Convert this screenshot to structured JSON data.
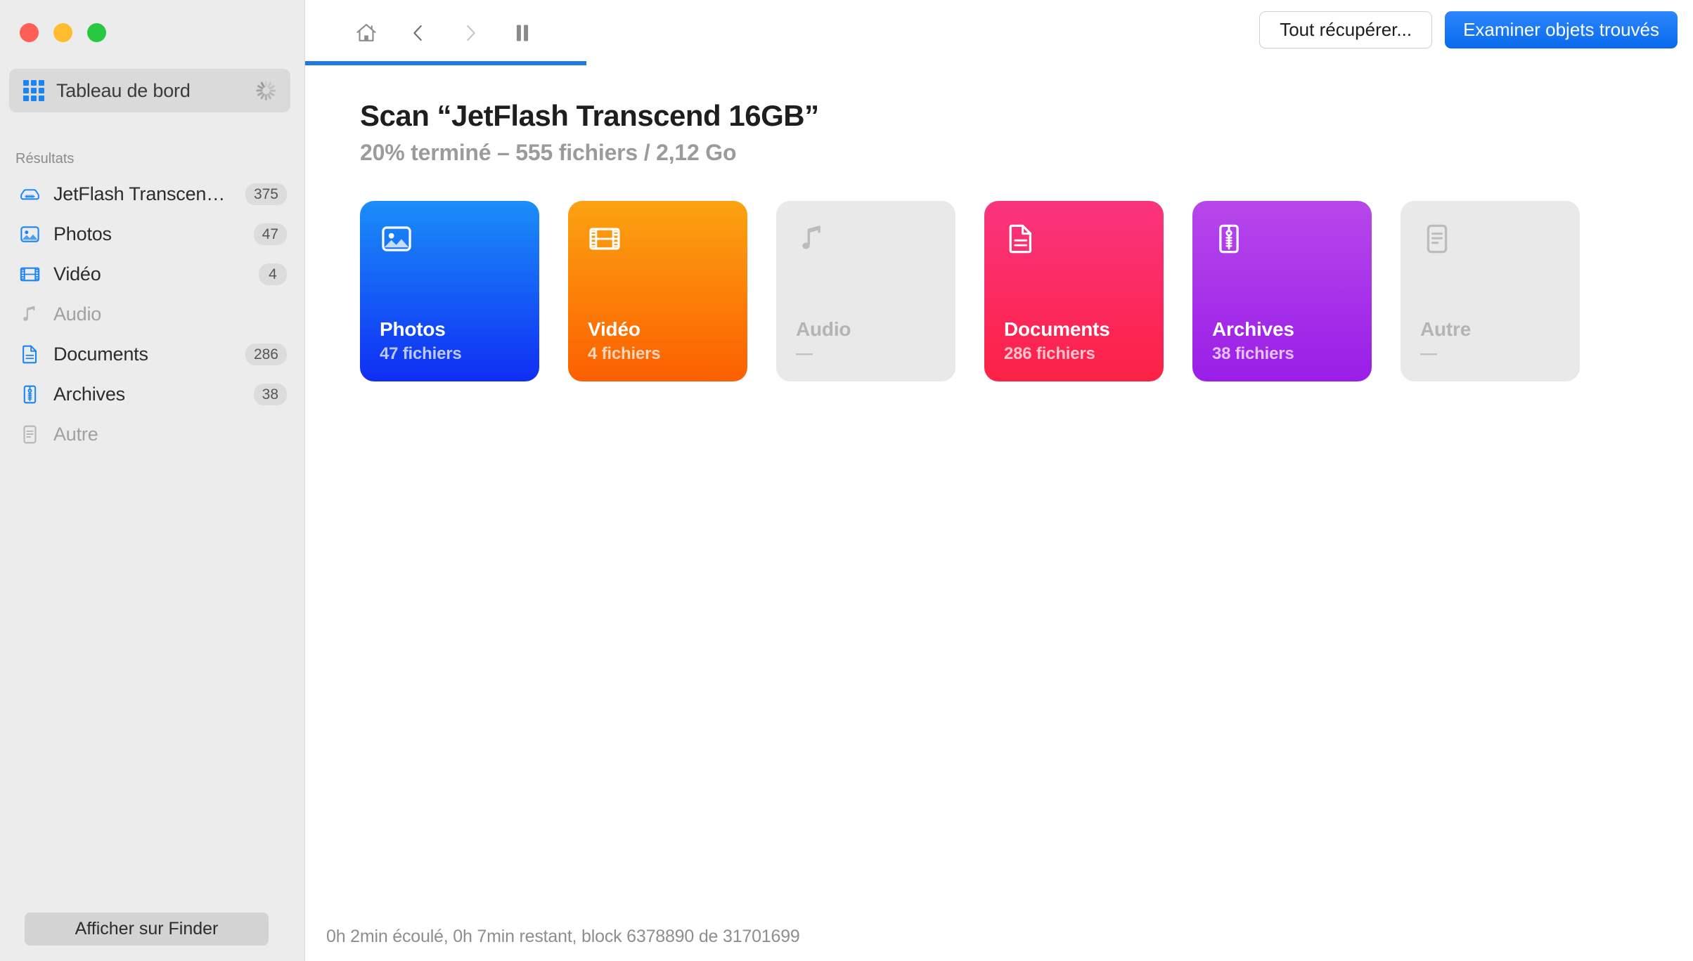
{
  "window": {
    "traffic_lights": [
      {
        "name": "close",
        "color": "#ff5f57"
      },
      {
        "name": "minimize",
        "color": "#febc2e"
      },
      {
        "name": "maximize",
        "color": "#28c840"
      }
    ]
  },
  "sidebar": {
    "dashboard": {
      "label": "Tableau de bord",
      "icon": "grid-icon",
      "busy_icon": "spinner-icon",
      "selected": true
    },
    "section_title": "Résultats",
    "items": [
      {
        "label": "JetFlash Transcen…",
        "badge": "375",
        "icon": "drive-icon",
        "enabled": true
      },
      {
        "label": "Photos",
        "badge": "47",
        "icon": "photo-icon",
        "enabled": true
      },
      {
        "label": "Vidéo",
        "badge": "4",
        "icon": "film-icon",
        "enabled": true
      },
      {
        "label": "Audio",
        "badge": "",
        "icon": "music-note-icon",
        "enabled": false
      },
      {
        "label": "Documents",
        "badge": "286",
        "icon": "document-icon",
        "enabled": true
      },
      {
        "label": "Archives",
        "badge": "38",
        "icon": "zip-icon",
        "enabled": true
      },
      {
        "label": "Autre",
        "badge": "",
        "icon": "other-file-icon",
        "enabled": false
      }
    ],
    "finder_button": "Afficher sur Finder"
  },
  "toolbar": {
    "home_icon": "home-icon",
    "back_icon": "chevron-left-icon",
    "forward_icon": "chevron-right-icon",
    "pause_icon": "pause-icon",
    "recover_all_label": "Tout récupérer...",
    "examine_label": "Examiner objets trouvés",
    "accent_color": "#2176e8"
  },
  "main": {
    "title": "Scan “JetFlash Transcend 16GB”",
    "subtitle": "20% terminé – 555 fichiers / 2,12 Go",
    "cards": [
      {
        "title": "Photos",
        "count": "47 fichiers",
        "icon": "photo-icon",
        "enabled": true,
        "color": "#1b8ef8"
      },
      {
        "title": "Vidéo",
        "count": "4 fichiers",
        "icon": "film-icon",
        "enabled": true,
        "color": "#fba311"
      },
      {
        "title": "Audio",
        "count": "—",
        "icon": "music-note-icon",
        "enabled": false,
        "color": "#e9e9e9"
      },
      {
        "title": "Documents",
        "count": "286 fichiers",
        "icon": "document-icon",
        "enabled": true,
        "color": "#f9347e"
      },
      {
        "title": "Archives",
        "count": "38 fichiers",
        "icon": "zip-icon",
        "enabled": true,
        "color": "#b747ea"
      },
      {
        "title": "Autre",
        "count": "—",
        "icon": "other-file-icon",
        "enabled": false,
        "color": "#e9e9e9"
      }
    ],
    "status": "0h 2min écoulé, 0h 7min restant, block 6378890 de 31701699"
  }
}
